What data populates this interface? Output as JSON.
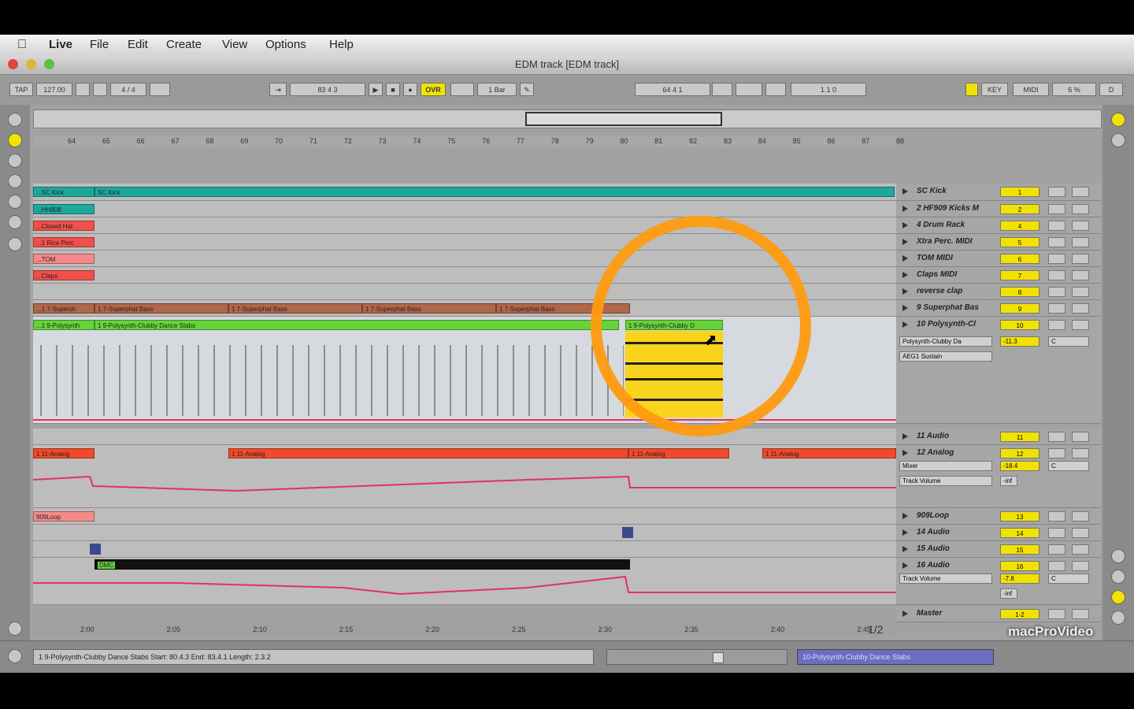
{
  "menu": {
    "apple": "",
    "items": [
      "Live",
      "File",
      "Edit",
      "Create",
      "View",
      "Options",
      "Help"
    ]
  },
  "window": {
    "title": "EDM track  [EDM track]"
  },
  "control_bar": {
    "tap": "TAP",
    "tempo": "127.00",
    "time_sig": "4 / 4",
    "position": "83     4     3",
    "ovr": "OVR",
    "quantize": "1 Bar",
    "loop_start": "64     4     1",
    "loop_length": "1     1     0",
    "key": "KEY",
    "midi": "MIDI",
    "cpu": "6 %",
    "d_label": "D"
  },
  "ruler": {
    "bars": [
      "64",
      "65",
      "66",
      "67",
      "68",
      "69",
      "70",
      "71",
      "72",
      "73",
      "74",
      "75",
      "76",
      "77",
      "78",
      "79",
      "80",
      "81",
      "82",
      "83",
      "84",
      "85",
      "86",
      "87",
      "88"
    ]
  },
  "timebar": {
    "times": [
      "2:00",
      "2:05",
      "2:10",
      "2:15",
      "2:20",
      "2:25",
      "2:30",
      "2:35",
      "2:40",
      "2:45"
    ],
    "page": "1/2"
  },
  "clips": {
    "kick": [
      "...SC Kick",
      "SC Kick"
    ],
    "hh808": "...HH808",
    "closed_hat": "...Closed Hat",
    "rice_perc": "...1 Rice Perc",
    "tom": "...TOM",
    "claps": "...Claps",
    "bass": [
      "...1 7-Supersh",
      "1 7-Superphat Bass",
      "1 7-Superphat Bass",
      "1 7-Superphat Bass",
      "1 7-Superphat Bass"
    ],
    "poly": [
      "...1 9-Polysynth",
      "1 9-Polysynth-Clubby Dance Stabs",
      "1 9-Polysynth-Clubby D"
    ],
    "analog": [
      "1 11-Analog",
      "1 11-Analog",
      "1 11-Analog",
      "1 11-Analog"
    ],
    "loop909": "909Loop",
    "dmc": "DMC"
  },
  "tracks": [
    {
      "name": "SC Kick",
      "num": "1"
    },
    {
      "name": "2 HF909 Kicks M",
      "num": "2"
    },
    {
      "name": "4 Drum Rack",
      "num": "4"
    },
    {
      "name": "Xtra Perc. MIDI",
      "num": "5"
    },
    {
      "name": "TOM MIDI",
      "num": "6"
    },
    {
      "name": "Claps MIDI",
      "num": "7"
    },
    {
      "name": "reverse clap",
      "num": "8"
    },
    {
      "name": "9 Superphat Bas",
      "num": "9"
    },
    {
      "name": "10 Polysynth-Cl",
      "num": "10"
    },
    {
      "name": "11 Audio",
      "num": "11"
    },
    {
      "name": "12 Analog",
      "num": "12"
    },
    {
      "name": "909Loop",
      "num": "13"
    },
    {
      "name": "14 Audio",
      "num": "14"
    },
    {
      "name": "15 Audio",
      "num": "15"
    },
    {
      "name": "16 Audio",
      "num": "16"
    },
    {
      "name": "Master",
      "num": "1-2"
    }
  ],
  "track_details": {
    "poly_device": "Polysynth-Clubby Da",
    "poly_param": "AEG1 Sustain",
    "poly_vol": "-11.3",
    "poly_pan": "C",
    "analog_device": "Mixer",
    "analog_param": "Track Volume",
    "analog_vol": "-18.4",
    "analog_pan": "C",
    "audio16_param": "Track Volume",
    "audio16_vol": "-7.8",
    "audio16_pan": "C",
    "inf": "-inf"
  },
  "status": {
    "text": "1 9-Polysynth-Clubby Dance Stabs  Start: 80.4.3  End: 83.4.1  Length: 2.3.2",
    "right": "10-Polysynth-Clubby Dance Stabs"
  },
  "watermark": "macProVideo",
  "colors": {
    "teal": "#1ea89a",
    "red_clip": "#f0504a",
    "bass": "#b0664a",
    "poly": "#66d33b",
    "analog": "#f04a2a",
    "selection": "#f8d41a",
    "highlight": "#ff9b0f",
    "automation": "#e0306a"
  }
}
